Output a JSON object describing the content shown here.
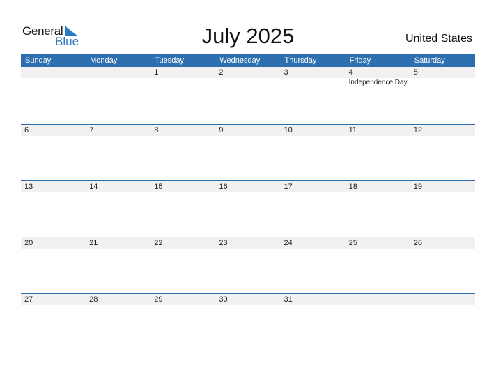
{
  "logo": {
    "word1": "General",
    "word2": "Blue"
  },
  "title": "July 2025",
  "country": "United States",
  "weekdays": [
    "Sunday",
    "Monday",
    "Tuesday",
    "Wednesday",
    "Thursday",
    "Friday",
    "Saturday"
  ],
  "weeks": [
    {
      "days": [
        "",
        "",
        "1",
        "2",
        "3",
        "4",
        "5"
      ],
      "events": [
        "",
        "",
        "",
        "",
        "",
        "Independence Day",
        ""
      ]
    },
    {
      "days": [
        "6",
        "7",
        "8",
        "9",
        "10",
        "11",
        "12"
      ],
      "events": [
        "",
        "",
        "",
        "",
        "",
        "",
        ""
      ]
    },
    {
      "days": [
        "13",
        "14",
        "15",
        "16",
        "17",
        "18",
        "19"
      ],
      "events": [
        "",
        "",
        "",
        "",
        "",
        "",
        ""
      ]
    },
    {
      "days": [
        "20",
        "21",
        "22",
        "23",
        "24",
        "25",
        "26"
      ],
      "events": [
        "",
        "",
        "",
        "",
        "",
        "",
        ""
      ]
    },
    {
      "days": [
        "27",
        "28",
        "29",
        "30",
        "31",
        "",
        ""
      ],
      "events": [
        "",
        "",
        "",
        "",
        "",
        "",
        ""
      ]
    }
  ]
}
